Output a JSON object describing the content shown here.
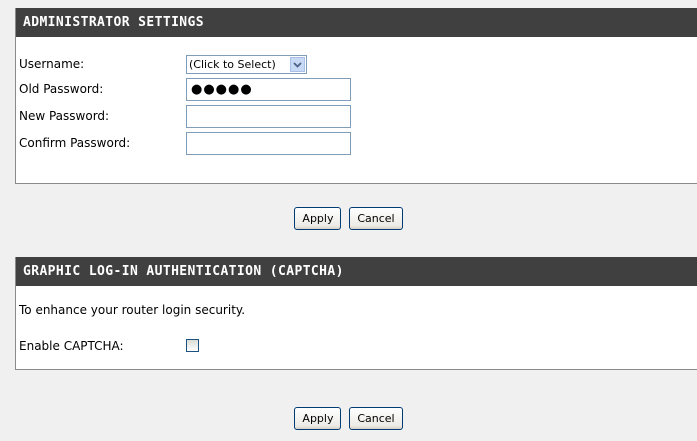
{
  "admin": {
    "title": "ADMINISTRATOR SETTINGS",
    "username_label": "Username:",
    "username_value": "(Click to Select)",
    "old_password_label": "Old Password:",
    "old_password_value": "●●●●●",
    "new_password_label": "New Password:",
    "new_password_value": "",
    "confirm_password_label": "Confirm Password:",
    "confirm_password_value": ""
  },
  "buttons_top": {
    "apply": "Apply",
    "cancel": "Cancel"
  },
  "captcha": {
    "title": "GRAPHIC LOG-IN AUTHENTICATION (CAPTCHA)",
    "description": "To enhance your router login security.",
    "enable_label": "Enable CAPTCHA:",
    "enable_checked": false
  },
  "buttons_bottom": {
    "apply": "Apply",
    "cancel": "Cancel"
  },
  "icons": {
    "dropdown": "chevron-down-icon"
  },
  "colors": {
    "header_bg": "#404040",
    "page_bg": "#f0f0f0",
    "input_border": "#7f9db9"
  }
}
